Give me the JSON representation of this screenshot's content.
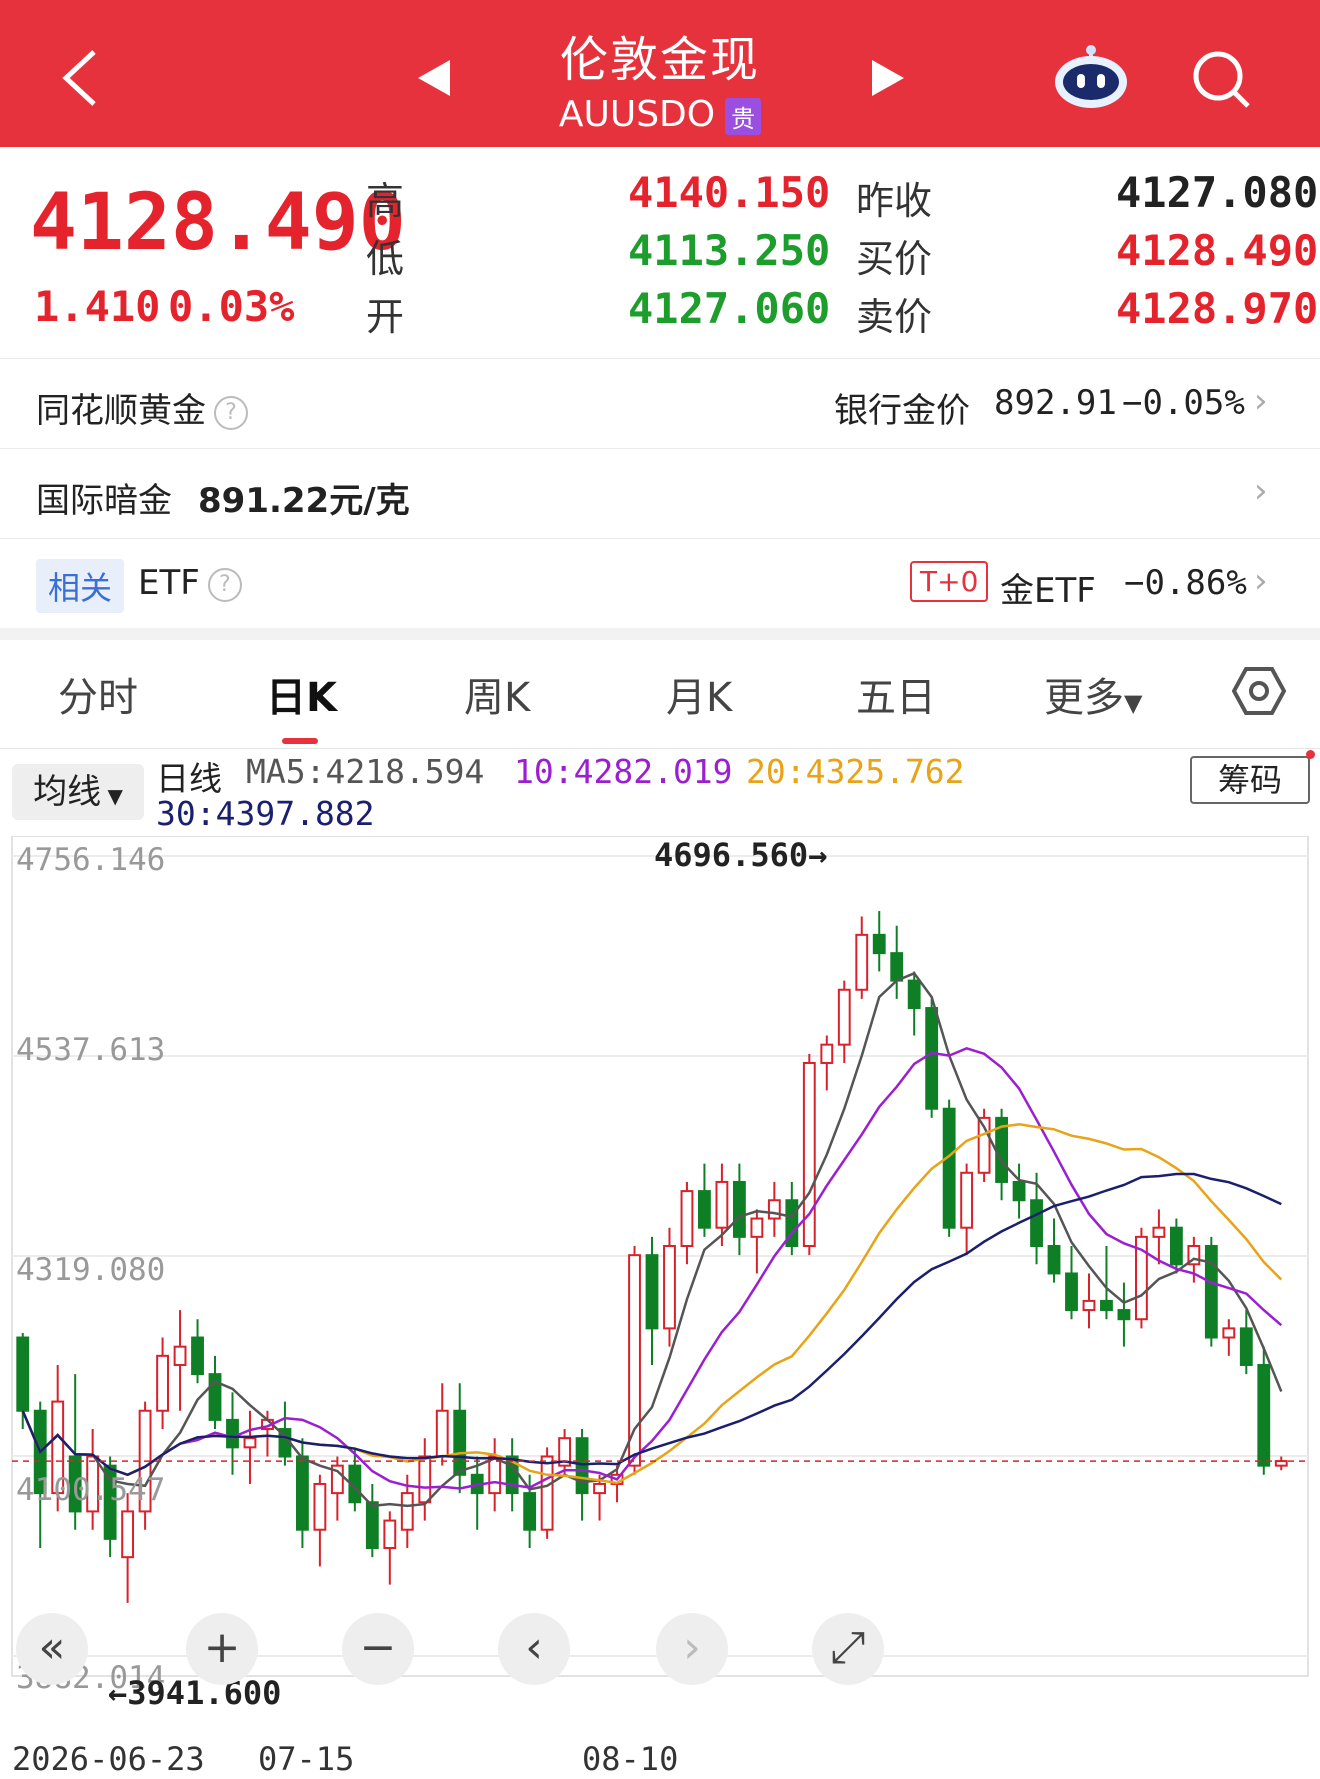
{
  "header": {
    "title": "伦敦金现",
    "code": "AUUSDO",
    "tag": "贵",
    "colors": {
      "bar": "#e5323c"
    }
  },
  "quote": {
    "price": "4128.490",
    "change": "1.410",
    "change_pct": "0.03%",
    "high_label": "高",
    "high": "4140.150",
    "low_label": "低",
    "low": "4113.250",
    "open_label": "开",
    "open": "4127.060",
    "prev_close_label": "昨收",
    "prev_close": "4127.080",
    "bid_label": "买价",
    "bid": "4128.490",
    "ask_label": "卖价",
    "ask": "4128.970"
  },
  "rows": {
    "ths_gold": "同花顺黄金",
    "bank_gold_label": "银行金价",
    "bank_gold_price": "892.91",
    "bank_gold_pct": "−0.05%",
    "intl_dark_label": "国际暗金",
    "intl_dark_price": "891.22元/克",
    "related_tag": "相关",
    "related_etf": "ETF",
    "t0_tag": "T+0",
    "gold_etf_label": "金ETF",
    "gold_etf_pct": "−0.86%"
  },
  "tabs": [
    "分时",
    "日K",
    "周K",
    "月K",
    "五日",
    "更多"
  ],
  "active_tab": 1,
  "chart_header": {
    "indicator_button": "均线",
    "period": "日线",
    "ma5": "MA5:4218.594",
    "ma10": "10:4282.019",
    "ma20": "20:4325.762",
    "ma30": "30:4397.882",
    "chips_button": "筹码",
    "colors": {
      "ma5": "#555555",
      "ma10": "#9b1fd1",
      "ma20": "#e8a317",
      "ma30": "#1a1f6e"
    }
  },
  "chart_data": {
    "type": "candlestick",
    "y_ticks": [
      "4756.146",
      "4537.613",
      "4319.080",
      "4100.547",
      "3882.014"
    ],
    "ylim": [
      3882.014,
      4756.146
    ],
    "x_ticks": [
      "2026-06-23",
      "07-15",
      "08-10"
    ],
    "annotations": {
      "max": "4696.560→",
      "min": "←3941.600"
    },
    "candles": [
      [
        4230,
        4235,
        4130,
        4150
      ],
      [
        4150,
        4160,
        4000,
        4060
      ],
      [
        4060,
        4200,
        4040,
        4160
      ],
      [
        4100,
        4190,
        4020,
        4040
      ],
      [
        4040,
        4130,
        4020,
        4100
      ],
      [
        4090,
        4100,
        3990,
        4010
      ],
      [
        3990,
        4060,
        3940,
        4040
      ],
      [
        4040,
        4160,
        4020,
        4150
      ],
      [
        4150,
        4230,
        4130,
        4210
      ],
      [
        4200,
        4260,
        4150,
        4220
      ],
      [
        4230,
        4250,
        4180,
        4190
      ],
      [
        4190,
        4210,
        4130,
        4140
      ],
      [
        4140,
        4170,
        4080,
        4110
      ],
      [
        4110,
        4150,
        4070,
        4120
      ],
      [
        4130,
        4150,
        4100,
        4140
      ],
      [
        4130,
        4160,
        4090,
        4100
      ],
      [
        4100,
        4120,
        4000,
        4020
      ],
      [
        4020,
        4080,
        3980,
        4070
      ],
      [
        4060,
        4100,
        4030,
        4090
      ],
      [
        4090,
        4110,
        4040,
        4050
      ],
      [
        4050,
        4070,
        3990,
        4000
      ],
      [
        4000,
        4040,
        3960,
        4030
      ],
      [
        4020,
        4080,
        4000,
        4060
      ],
      [
        4050,
        4120,
        4030,
        4100
      ],
      [
        4100,
        4180,
        4090,
        4150
      ],
      [
        4150,
        4180,
        4060,
        4080
      ],
      [
        4080,
        4100,
        4020,
        4060
      ],
      [
        4060,
        4120,
        4040,
        4100
      ],
      [
        4100,
        4120,
        4040,
        4060
      ],
      [
        4060,
        4080,
        4000,
        4020
      ],
      [
        4020,
        4110,
        4010,
        4100
      ],
      [
        4090,
        4130,
        4080,
        4120
      ],
      [
        4120,
        4130,
        4030,
        4060
      ],
      [
        4060,
        4080,
        4030,
        4070
      ],
      [
        4070,
        4090,
        4050,
        4080
      ],
      [
        4090,
        4330,
        4080,
        4320
      ],
      [
        4320,
        4340,
        4200,
        4240
      ],
      [
        4240,
        4350,
        4220,
        4330
      ],
      [
        4330,
        4400,
        4310,
        4390
      ],
      [
        4390,
        4420,
        4340,
        4350
      ],
      [
        4350,
        4420,
        4330,
        4400
      ],
      [
        4400,
        4420,
        4320,
        4340
      ],
      [
        4340,
        4370,
        4300,
        4360
      ],
      [
        4360,
        4400,
        4340,
        4380
      ],
      [
        4380,
        4400,
        4320,
        4330
      ],
      [
        4330,
        4540,
        4320,
        4530
      ],
      [
        4530,
        4560,
        4500,
        4550
      ],
      [
        4550,
        4620,
        4530,
        4610
      ],
      [
        4610,
        4690,
        4600,
        4670
      ],
      [
        4670,
        4696,
        4630,
        4650
      ],
      [
        4650,
        4680,
        4600,
        4620
      ],
      [
        4620,
        4630,
        4560,
        4590
      ],
      [
        4590,
        4600,
        4470,
        4480
      ],
      [
        4480,
        4490,
        4340,
        4350
      ],
      [
        4350,
        4420,
        4320,
        4410
      ],
      [
        4410,
        4480,
        4400,
        4470
      ],
      [
        4470,
        4480,
        4380,
        4400
      ],
      [
        4400,
        4420,
        4360,
        4380
      ],
      [
        4380,
        4410,
        4310,
        4330
      ],
      [
        4330,
        4360,
        4290,
        4300
      ],
      [
        4300,
        4330,
        4250,
        4260
      ],
      [
        4260,
        4300,
        4240,
        4270
      ],
      [
        4270,
        4330,
        4250,
        4260
      ],
      [
        4260,
        4290,
        4220,
        4250
      ],
      [
        4250,
        4350,
        4240,
        4340
      ],
      [
        4340,
        4370,
        4310,
        4350
      ],
      [
        4350,
        4360,
        4300,
        4310
      ],
      [
        4310,
        4340,
        4290,
        4330
      ],
      [
        4330,
        4340,
        4220,
        4230
      ],
      [
        4230,
        4250,
        4210,
        4240
      ],
      [
        4240,
        4260,
        4190,
        4200
      ],
      [
        4200,
        4220,
        4080,
        4090
      ],
      [
        4090,
        4100,
        4085,
        4095
      ]
    ]
  },
  "controls": [
    "«",
    "+",
    "−",
    "‹",
    "›",
    "⤢"
  ]
}
